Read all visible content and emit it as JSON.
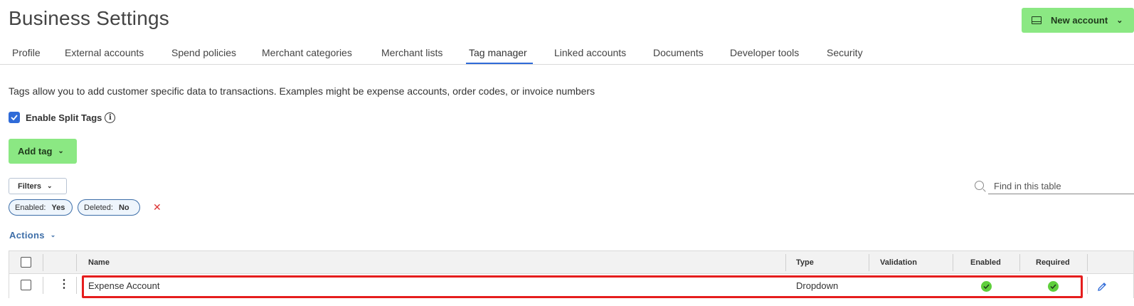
{
  "header": {
    "title": "Business Settings",
    "new_account_label": "New account"
  },
  "tabs": [
    {
      "label": "Profile"
    },
    {
      "label": "External accounts"
    },
    {
      "label": "Spend policies"
    },
    {
      "label": "Merchant categories"
    },
    {
      "label": "Merchant lists"
    },
    {
      "label": "Tag manager",
      "active": true
    },
    {
      "label": "Linked accounts"
    },
    {
      "label": "Documents"
    },
    {
      "label": "Developer tools"
    },
    {
      "label": "Security"
    }
  ],
  "main": {
    "description": "Tags allow you to add customer specific data to transactions. Examples might be expense accounts, order codes, or invoice numbers",
    "split_tags": {
      "label": "Enable Split Tags",
      "checked": true,
      "info_glyph": "i"
    },
    "add_tag_label": "Add tag",
    "filters_label": "Filters",
    "search": {
      "placeholder": "Find in this table",
      "value": ""
    },
    "chips": [
      {
        "key": "Enabled:",
        "value": "Yes"
      },
      {
        "key": "Deleted:",
        "value": "No"
      }
    ],
    "clear_glyph": "✕",
    "actions_label": "Actions"
  },
  "table": {
    "columns": [
      "Name",
      "Type",
      "Validation",
      "Enabled",
      "Required"
    ],
    "rows": [
      {
        "name": "Expense Account",
        "type": "Dropdown",
        "validation": "",
        "enabled": true,
        "required": true,
        "highlighted": true
      }
    ]
  },
  "colors": {
    "accent": "#2f6bd8",
    "primary_button": "#8be883",
    "highlight": "#e51d1d",
    "status_ok": "#5fcf3c"
  },
  "icons": {
    "new_account": "card-icon",
    "chevron": "chevron-down-icon",
    "info": "info-icon",
    "search": "search-icon",
    "clear": "close-icon",
    "row_menu": "kebab-icon",
    "edit": "pencil-icon",
    "status": "check-circle-icon"
  }
}
